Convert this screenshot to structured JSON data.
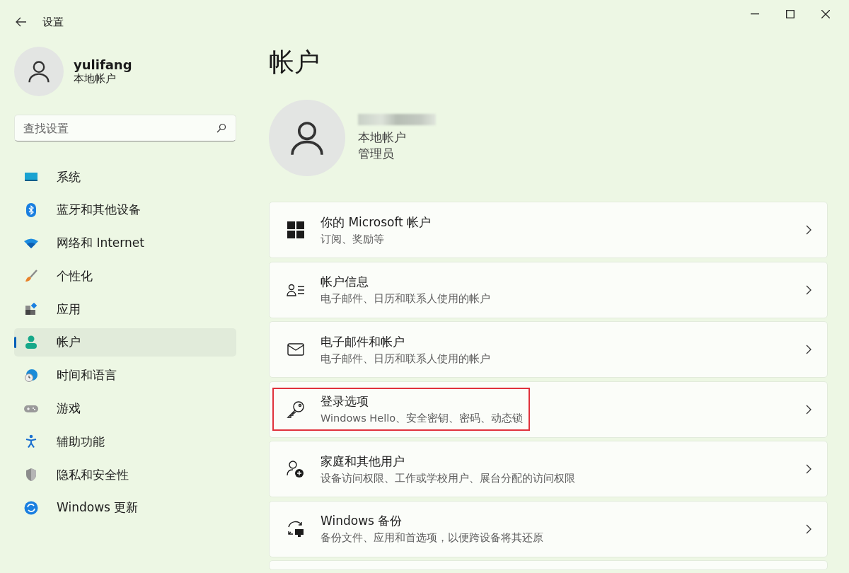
{
  "window": {
    "title": "设置"
  },
  "user": {
    "name": "yulifang",
    "type": "本地帐户"
  },
  "search": {
    "placeholder": "查找设置"
  },
  "nav": [
    {
      "label": "系统",
      "selected": false
    },
    {
      "label": "蓝牙和其他设备",
      "selected": false
    },
    {
      "label": "网络和 Internet",
      "selected": false
    },
    {
      "label": "个性化",
      "selected": false
    },
    {
      "label": "应用",
      "selected": false
    },
    {
      "label": "帐户",
      "selected": true
    },
    {
      "label": "时间和语言",
      "selected": false
    },
    {
      "label": "游戏",
      "selected": false
    },
    {
      "label": "辅助功能",
      "selected": false
    },
    {
      "label": "隐私和安全性",
      "selected": false
    },
    {
      "label": "Windows 更新",
      "selected": false
    }
  ],
  "page": {
    "title": "帐户"
  },
  "profile": {
    "lines": [
      "本地帐户",
      "管理员"
    ]
  },
  "cards": [
    {
      "title": "你的 Microsoft 帐户",
      "subtitle": "订阅、奖励等",
      "highlighted": false
    },
    {
      "title": "帐户信息",
      "subtitle": "电子邮件、日历和联系人使用的帐户",
      "highlighted": false
    },
    {
      "title": "电子邮件和帐户",
      "subtitle": "电子邮件、日历和联系人使用的帐户",
      "highlighted": false
    },
    {
      "title": "登录选项",
      "subtitle": "Windows Hello、安全密钥、密码、动态锁",
      "highlighted": true
    },
    {
      "title": "家庭和其他用户",
      "subtitle": "设备访问权限、工作或学校用户、展台分配的访问权限",
      "highlighted": false
    },
    {
      "title": "Windows 备份",
      "subtitle": "备份文件、应用和首选项，以便跨设备将其还原",
      "highlighted": false
    }
  ]
}
